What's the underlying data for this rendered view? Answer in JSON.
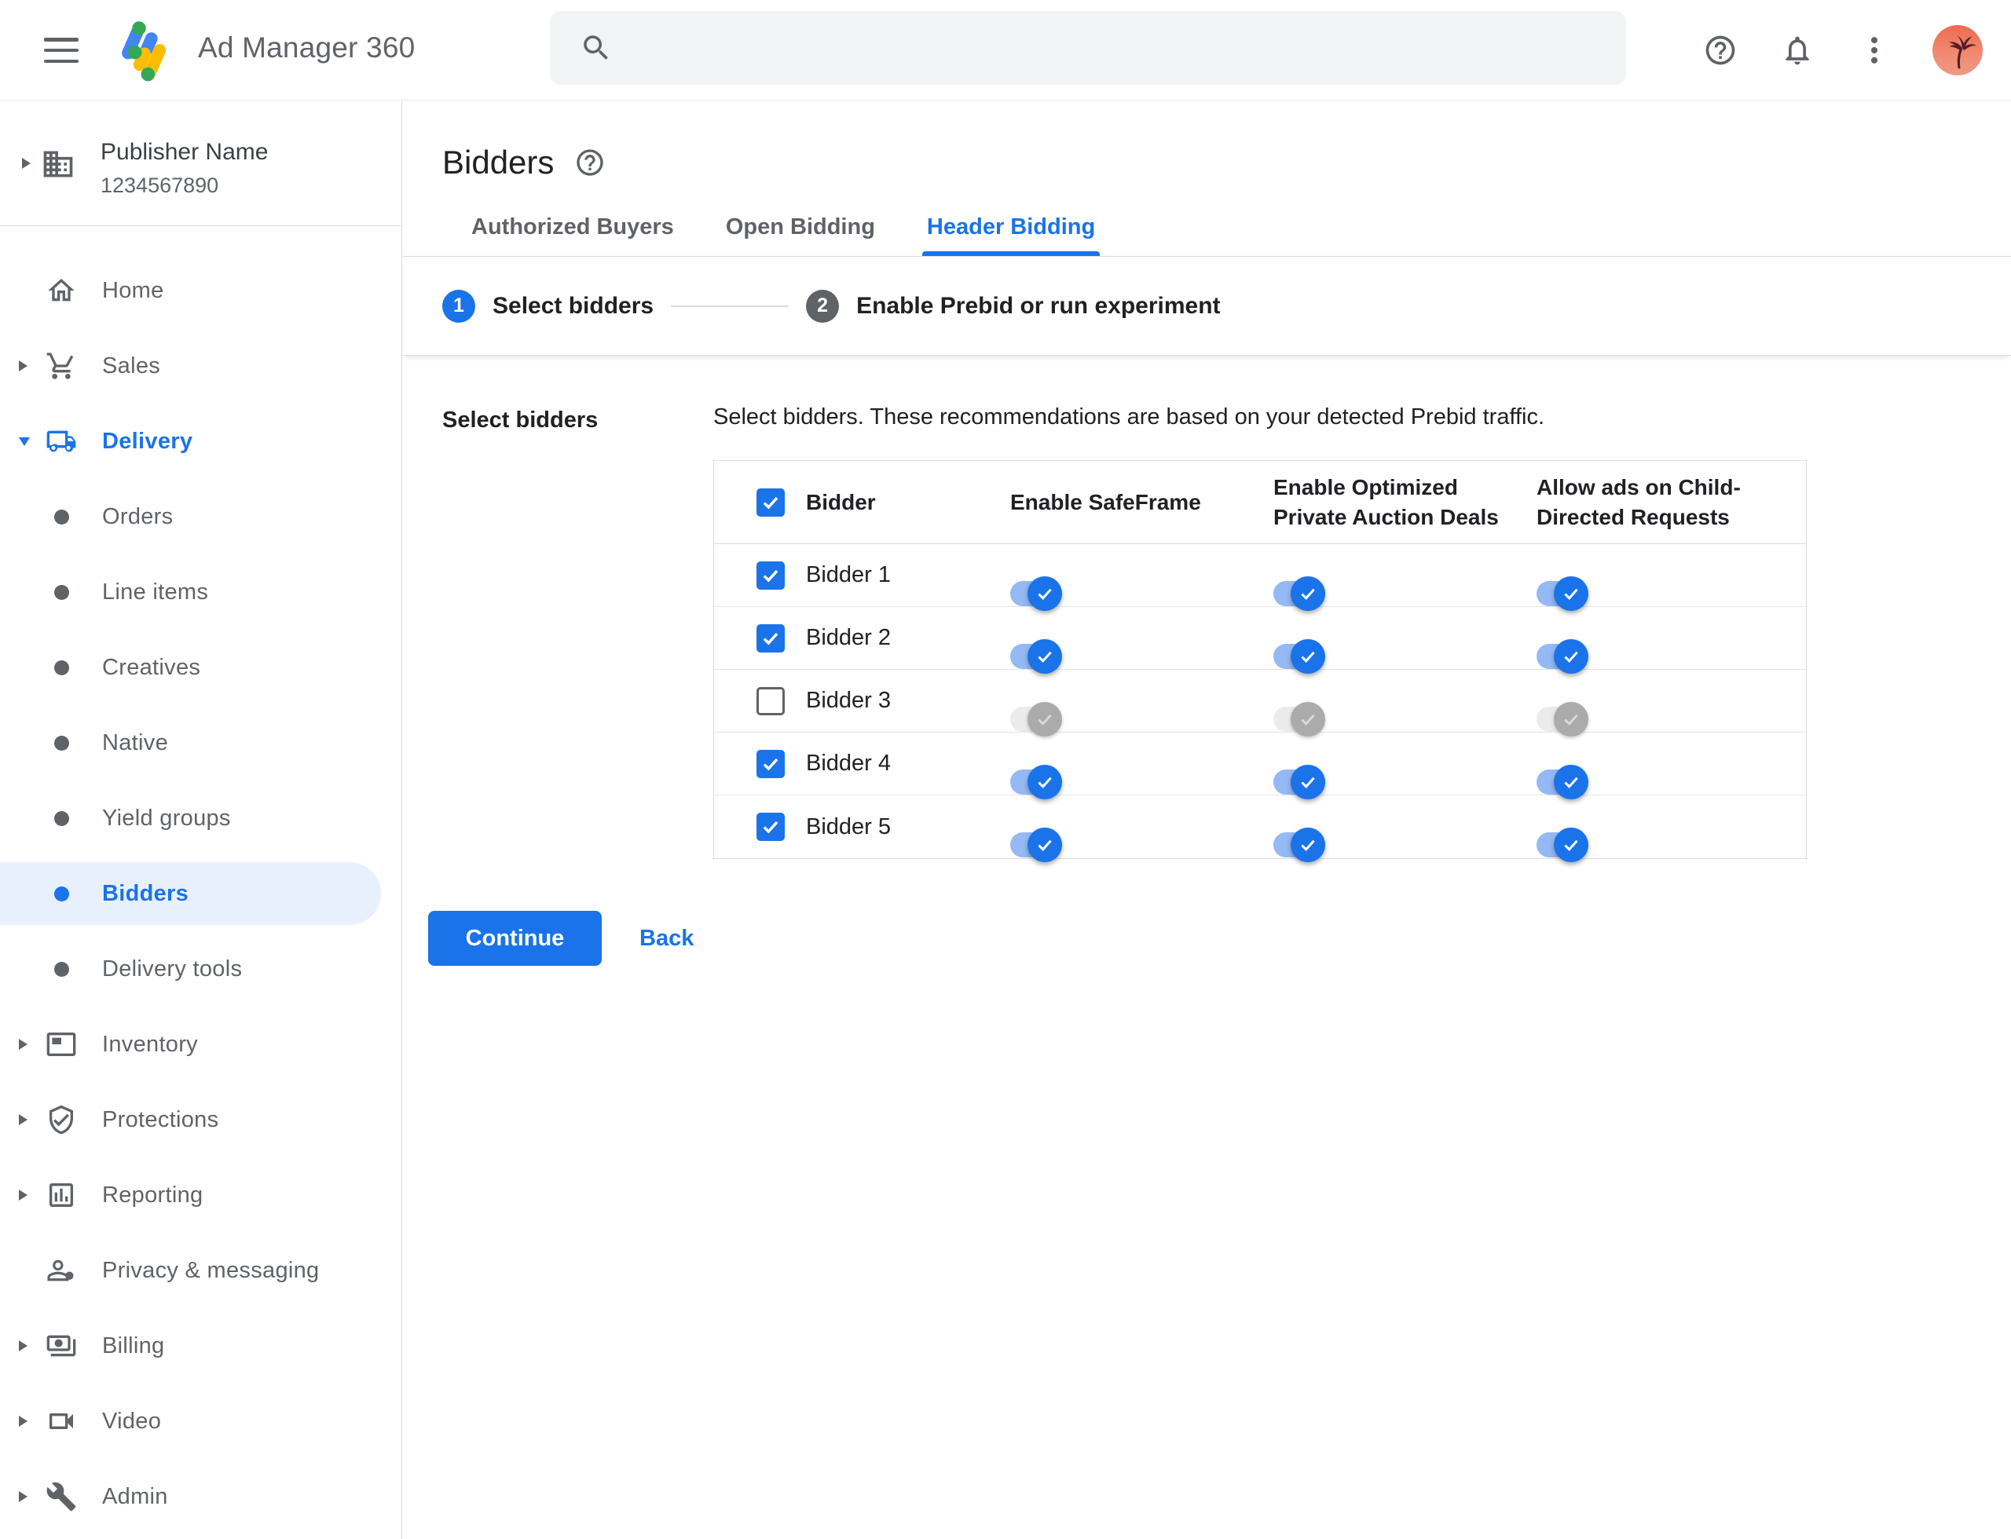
{
  "header": {
    "app_name": "Ad Manager 360",
    "search_placeholder": ""
  },
  "sidebar": {
    "publisher": {
      "name": "Publisher Name",
      "id": "1234567890"
    },
    "items": [
      {
        "label": "Home",
        "state": "default"
      },
      {
        "label": "Sales",
        "state": "default"
      },
      {
        "label": "Delivery",
        "state": "parent-active"
      },
      {
        "label": "Orders",
        "state": "default"
      },
      {
        "label": "Line items",
        "state": "default"
      },
      {
        "label": "Creatives",
        "state": "default"
      },
      {
        "label": "Native",
        "state": "default"
      },
      {
        "label": "Yield groups",
        "state": "default"
      },
      {
        "label": "Bidders",
        "state": "active"
      },
      {
        "label": "Delivery tools",
        "state": "default"
      },
      {
        "label": "Inventory",
        "state": "default"
      },
      {
        "label": "Protections",
        "state": "default"
      },
      {
        "label": "Reporting",
        "state": "default"
      },
      {
        "label": "Privacy & messaging",
        "state": "default"
      },
      {
        "label": "Billing",
        "state": "default"
      },
      {
        "label": "Video",
        "state": "default"
      },
      {
        "label": "Admin",
        "state": "default"
      }
    ]
  },
  "main": {
    "page_title": "Bidders",
    "tabs": [
      {
        "label": "Authorized Buyers",
        "state": "inactive"
      },
      {
        "label": "Open Bidding",
        "state": "inactive"
      },
      {
        "label": "Header Bidding",
        "state": "active"
      }
    ],
    "steps": [
      {
        "number": "1",
        "label": "Select bidders",
        "state": "active"
      },
      {
        "number": "2",
        "label": "Enable Prebid or run experiment",
        "state": "upcoming"
      }
    ],
    "section_label": "Select bidders",
    "description": "Select bidders. These recommendations are based on your detected Prebid traffic.",
    "table": {
      "header_checkbox_state": "checked",
      "columns": [
        "Bidder",
        "Enable SafeFrame",
        "Enable Optimized Private Auction Deals",
        "Allow ads on Child-Directed Requests"
      ],
      "rows": [
        {
          "name": "Bidder 1",
          "select_state": "checked",
          "safeframe": "on",
          "optimized": "on",
          "child_directed": "on"
        },
        {
          "name": "Bidder 2",
          "select_state": "checked",
          "safeframe": "on",
          "optimized": "on",
          "child_directed": "on"
        },
        {
          "name": "Bidder 3",
          "select_state": "unchecked",
          "safeframe": "off",
          "optimized": "off",
          "child_directed": "off"
        },
        {
          "name": "Bidder 4",
          "select_state": "checked",
          "safeframe": "on",
          "optimized": "on",
          "child_directed": "on"
        },
        {
          "name": "Bidder 5",
          "select_state": "checked",
          "safeframe": "on",
          "optimized": "on",
          "child_directed": "on"
        }
      ]
    },
    "actions": {
      "continue_label": "Continue",
      "back_label": "Back"
    }
  },
  "colors": {
    "accent": "#1a73e8",
    "accent_light_pill": "#e8f0fe",
    "toggle_track_on": "#94b9f5",
    "toggle_off_thumb": "#ababab",
    "logo_blue": "#4285f4",
    "logo_yellow": "#fbbc04",
    "logo_green": "#34a853",
    "text_primary": "#202124",
    "text_secondary": "#5f6368",
    "border": "#dadce0"
  }
}
